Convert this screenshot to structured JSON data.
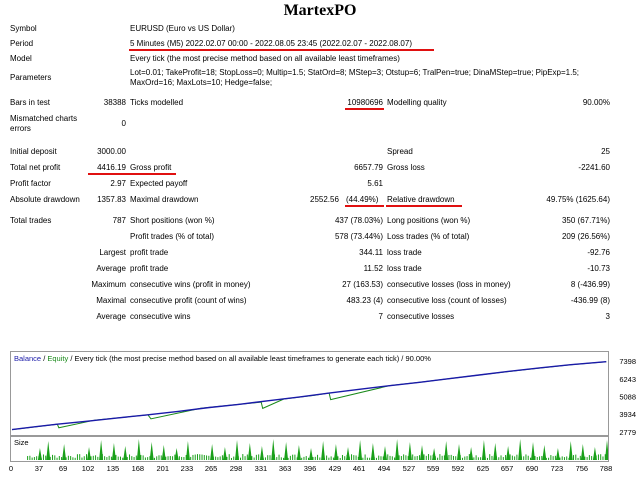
{
  "title": "MartexPO",
  "report": {
    "symbol_label": "Symbol",
    "symbol_value": "EURUSD (Euro vs US Dollar)",
    "period_label": "Period",
    "period_value": "5 Minutes (M5) 2022.02.07 00:00 - 2022.08.05 23:45 (2022.02.07 - 2022.08.07)",
    "model_label": "Model",
    "model_value": "Every tick (the most precise method based on all available least timeframes)",
    "params_label": "Parameters",
    "params_line1": "Lot=0.01; TakeProfit=18; StopLoss=0; Multip=1.5; StatOrd=8; MStep=3; Otstup=6; TralPen=true; DinaMStep=true; PipExp=1.5;",
    "params_line2": "MaxOrd=16; MaxLots=10; Hedge=false;",
    "bars_label": "Bars in test",
    "bars_value": "38388",
    "ticks_label": "Ticks modelled",
    "ticks_value": "10980696",
    "mq_label": "Modelling quality",
    "mq_value": "90.00%",
    "mismatch_label1": "Mismatched charts",
    "mismatch_label2": "errors",
    "mismatch_value": "0",
    "deposit_label": "Initial deposit",
    "deposit_value": "3000.00",
    "spread_label": "Spread",
    "spread_value": "25",
    "netprofit_label": "Total net profit",
    "netprofit_value": "4416.19",
    "grossprofit_label": "Gross profit",
    "grossprofit_value": "6657.79",
    "grossloss_label": "Gross loss",
    "grossloss_value": "-2241.60",
    "pf_label": "Profit factor",
    "pf_value": "2.97",
    "ep_label": "Expected payoff",
    "ep_value": "5.61",
    "absdd_label": "Absolute drawdown",
    "absdd_value": "1357.83",
    "maxdd_label": "Maximal drawdown",
    "maxdd_value": "2552.56",
    "maxdd_pct": "(44.49%)",
    "reldd_label": "Relative drawdown",
    "reldd_value": "49.75% (1625.64)",
    "trades_label": "Total trades",
    "trades_value": "787",
    "short_label": "Short positions (won %)",
    "short_value": "437 (78.03%)",
    "long_label": "Long positions (won %)",
    "long_value": "350 (67.71%)",
    "pt_label": "Profit trades (% of total)",
    "pt_value": "578 (73.44%)",
    "lt_label": "Loss trades (% of total)",
    "lt_value": "209 (26.56%)",
    "largest_label": "Largest",
    "largest_pt_label": "profit trade",
    "largest_pt_value": "344.11",
    "largest_lt_label": "loss trade",
    "largest_lt_value": "-92.76",
    "average_label": "Average",
    "average_pt_label": "profit trade",
    "average_pt_value": "11.52",
    "average_lt_label": "loss trade",
    "average_lt_value": "-10.73",
    "maximum_label": "Maximum",
    "max_cw_label": "consecutive wins (profit in money)",
    "max_cw_value": "27 (163.53)",
    "max_cl_label": "consecutive losses (loss in money)",
    "max_cl_value": "8 (-436.99)",
    "maximal_label": "Maximal",
    "maximal_cp_label": "consecutive profit (count of wins)",
    "maximal_cp_value": "483.23 (4)",
    "maximal_cl_label": "consecutive loss (count of losses)",
    "maximal_cl_value": "-436.99 (8)",
    "avg2_label": "Average",
    "avg_cw_label": "consecutive wins",
    "avg_cw_value": "7",
    "avg_cl_label": "consecutive losses",
    "avg_cl_value": "3"
  },
  "chart_legend": {
    "balance": "Balance",
    "sep": " / ",
    "equity": "Equity",
    "rest": " / Every tick (the most precise method based on all available least timeframes to generate each tick) / 90.00%"
  },
  "size_label": "Size",
  "colors": {
    "balance": "#1a1aa8",
    "equity": "#1a8a1a",
    "volume": "#1aa01a",
    "underline": "#e01010"
  },
  "chart_data": {
    "type": "line",
    "series": [
      {
        "name": "Balance",
        "x": [
          0,
          30,
          60,
          100,
          140,
          180,
          220,
          260,
          300,
          340,
          380,
          420,
          460,
          500,
          540,
          580,
          620,
          660,
          700,
          740,
          787
        ],
        "values": [
          3000,
          3180,
          3350,
          3550,
          3760,
          3960,
          4180,
          4430,
          4640,
          4880,
          5120,
          5380,
          5620,
          5860,
          6080,
          6320,
          6560,
          6800,
          7020,
          7220,
          7416
        ]
      },
      {
        "name": "Equity",
        "x": [
          0,
          60,
          62,
          110,
          180,
          184,
          250,
          300,
          330,
          332,
          360,
          400,
          420,
          422,
          500,
          540,
          620,
          680,
          740,
          787
        ],
        "values": [
          3000,
          3350,
          3120,
          3620,
          3960,
          3700,
          4390,
          4640,
          4790,
          4380,
          4990,
          5230,
          5380,
          4950,
          5860,
          6080,
          6560,
          6900,
          7220,
          7416
        ]
      }
    ],
    "yticks": [
      2779,
      3934,
      5088,
      6243,
      7398
    ],
    "xticks": [
      0,
      37,
      69,
      102,
      135,
      168,
      201,
      233,
      265,
      298,
      331,
      363,
      396,
      429,
      461,
      494,
      527,
      559,
      592,
      625,
      657,
      690,
      723,
      756,
      788
    ],
    "ylim": [
      2779,
      7398
    ],
    "xlim": [
      0,
      788
    ],
    "volume_peaks": [
      37,
      48,
      69,
      102,
      118,
      135,
      150,
      168,
      185,
      201,
      218,
      233,
      265,
      282,
      298,
      315,
      331,
      346,
      363,
      380,
      396,
      412,
      429,
      445,
      461,
      478,
      494,
      510,
      527,
      543,
      559,
      575,
      592,
      608,
      625,
      640,
      657,
      673,
      690,
      705,
      723,
      740,
      756,
      772,
      788
    ]
  }
}
